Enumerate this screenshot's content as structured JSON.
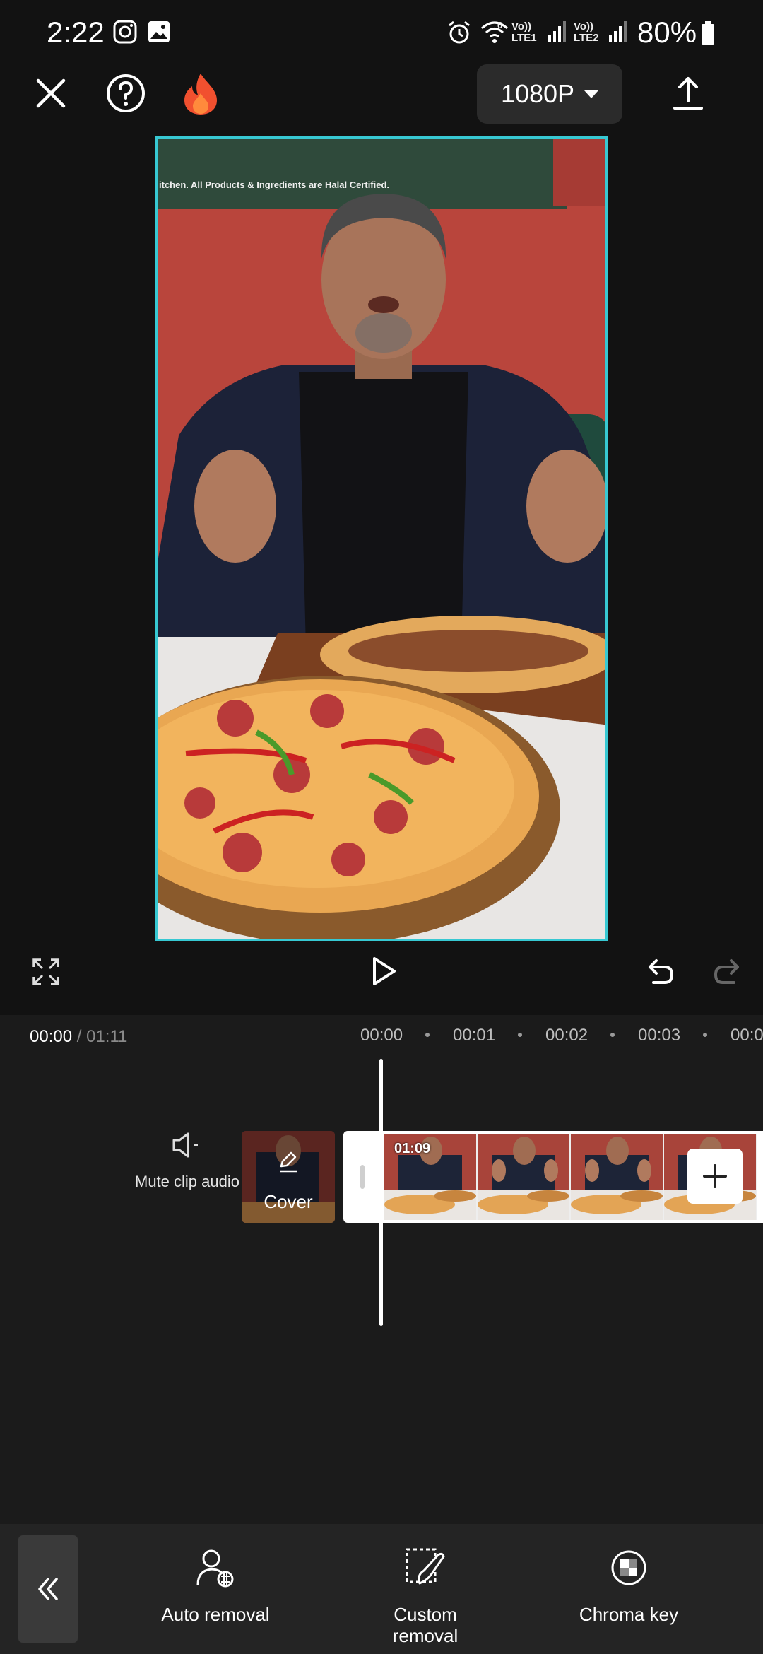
{
  "status": {
    "time": "2:22",
    "battery": "80%",
    "sim1": [
      "Vo))",
      "LTE1"
    ],
    "sim2": [
      "Vo))",
      "LTE2"
    ],
    "wifi_badge": "6"
  },
  "toolbar": {
    "resolution": "1080P"
  },
  "preview": {
    "banner_text": "itchen. All Products & Ingredients are Halal Certified."
  },
  "timeline": {
    "current_time": "00:00",
    "separator": " / ",
    "total_time": "01:11",
    "ruler": [
      "00:00",
      "00:01",
      "00:02",
      "00:03",
      "00:0"
    ],
    "mute_label": "Mute clip audio",
    "cover_label": "Cover",
    "clip_duration": "01:09"
  },
  "tools": {
    "auto_removal": "Auto removal",
    "custom_removal_1": "Custom",
    "custom_removal_2": "removal",
    "chroma_key": "Chroma key"
  },
  "colors": {
    "accent_border": "#37c8d2",
    "background": "#121212",
    "toolbar": "#242424"
  }
}
